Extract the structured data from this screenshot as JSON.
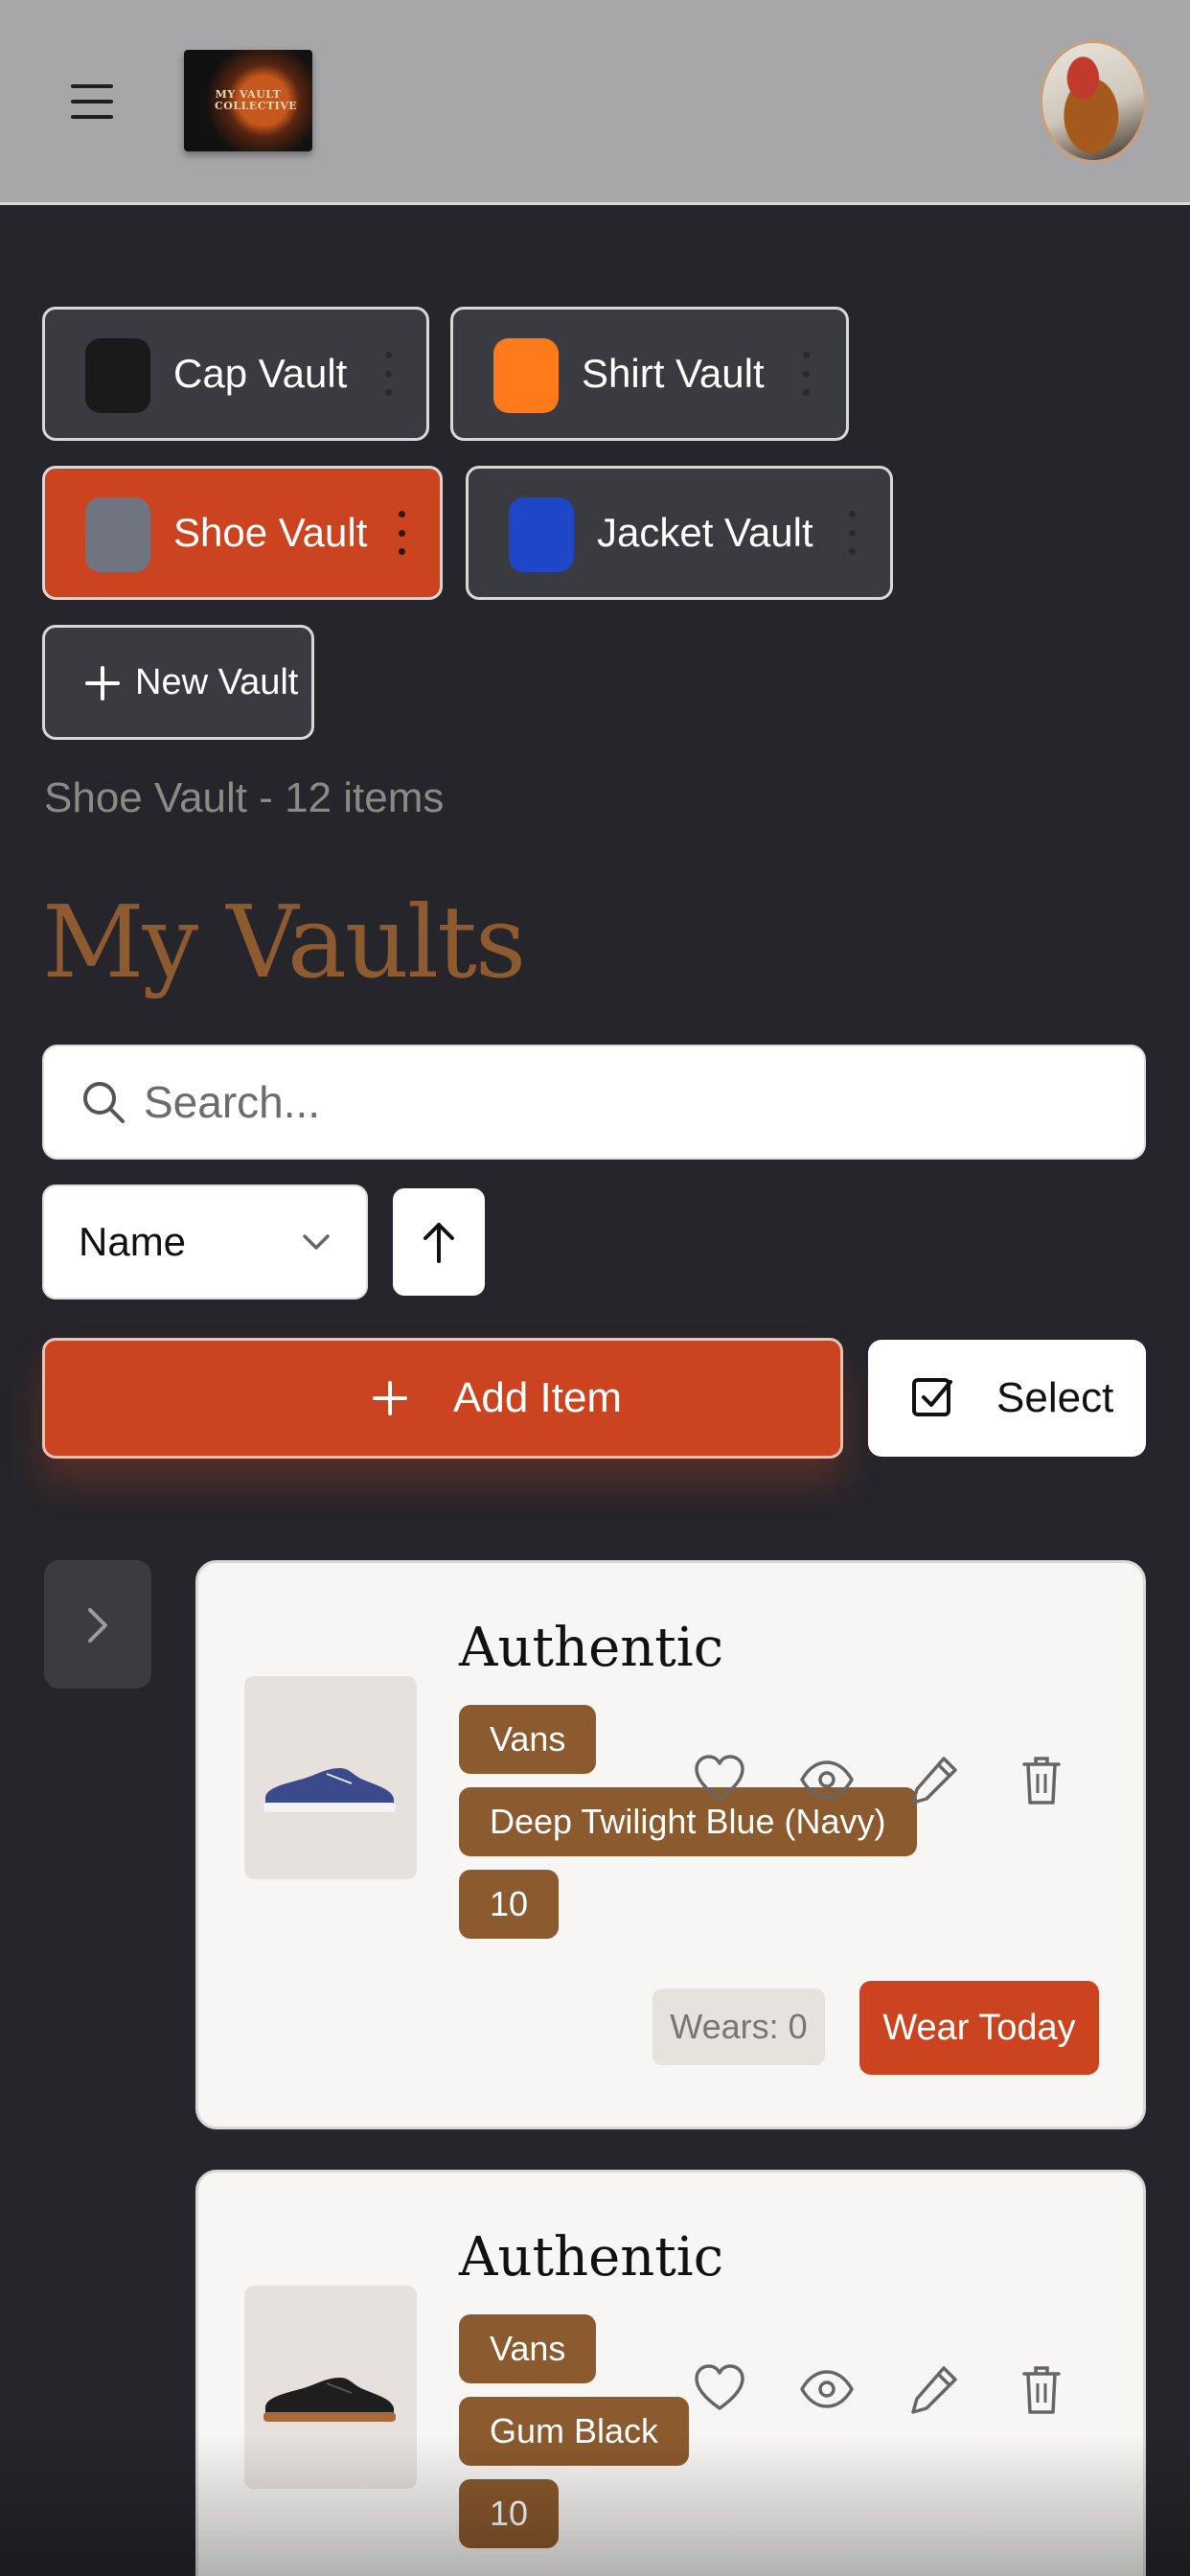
{
  "header": {
    "logo_text": "MY VAULT COLLECTIVE",
    "menu_icon": "hamburger-icon",
    "avatar_icon": "user-avatar"
  },
  "vaults": [
    {
      "label": "Cap Vault",
      "color": "#1a1a1a",
      "active": false
    },
    {
      "label": "Shirt Vault",
      "color": "#ff7a1a",
      "active": false
    },
    {
      "label": "Shoe Vault",
      "color": "#6f7480",
      "active": true
    },
    {
      "label": "Jacket Vault",
      "color": "#1f45c8",
      "active": false
    }
  ],
  "new_vault_label": "New Vault",
  "subtitle": "Shoe Vault - 12 items",
  "page_title": "My Vaults",
  "search": {
    "placeholder": "Search..."
  },
  "sort": {
    "selected": "Name",
    "direction_icon": "arrow-up-icon"
  },
  "actions": {
    "add_item": "Add Item",
    "select": "Select"
  },
  "colors": {
    "accent": "#cb441f",
    "tag": "#8b5a2e",
    "background": "#26252b",
    "title": "#8e5a30"
  },
  "items": [
    {
      "name": "Authentic",
      "tags": [
        "Vans",
        "Deep Twilight Blue (Navy)",
        "10"
      ],
      "wears": "Wears: 0",
      "wear_today": "Wear Today",
      "shoe_color": "#3b4a8c"
    },
    {
      "name": "Authentic",
      "tags": [
        "Vans",
        "Gum Black",
        "10"
      ],
      "shoe_color": "#1e1e1e"
    }
  ]
}
